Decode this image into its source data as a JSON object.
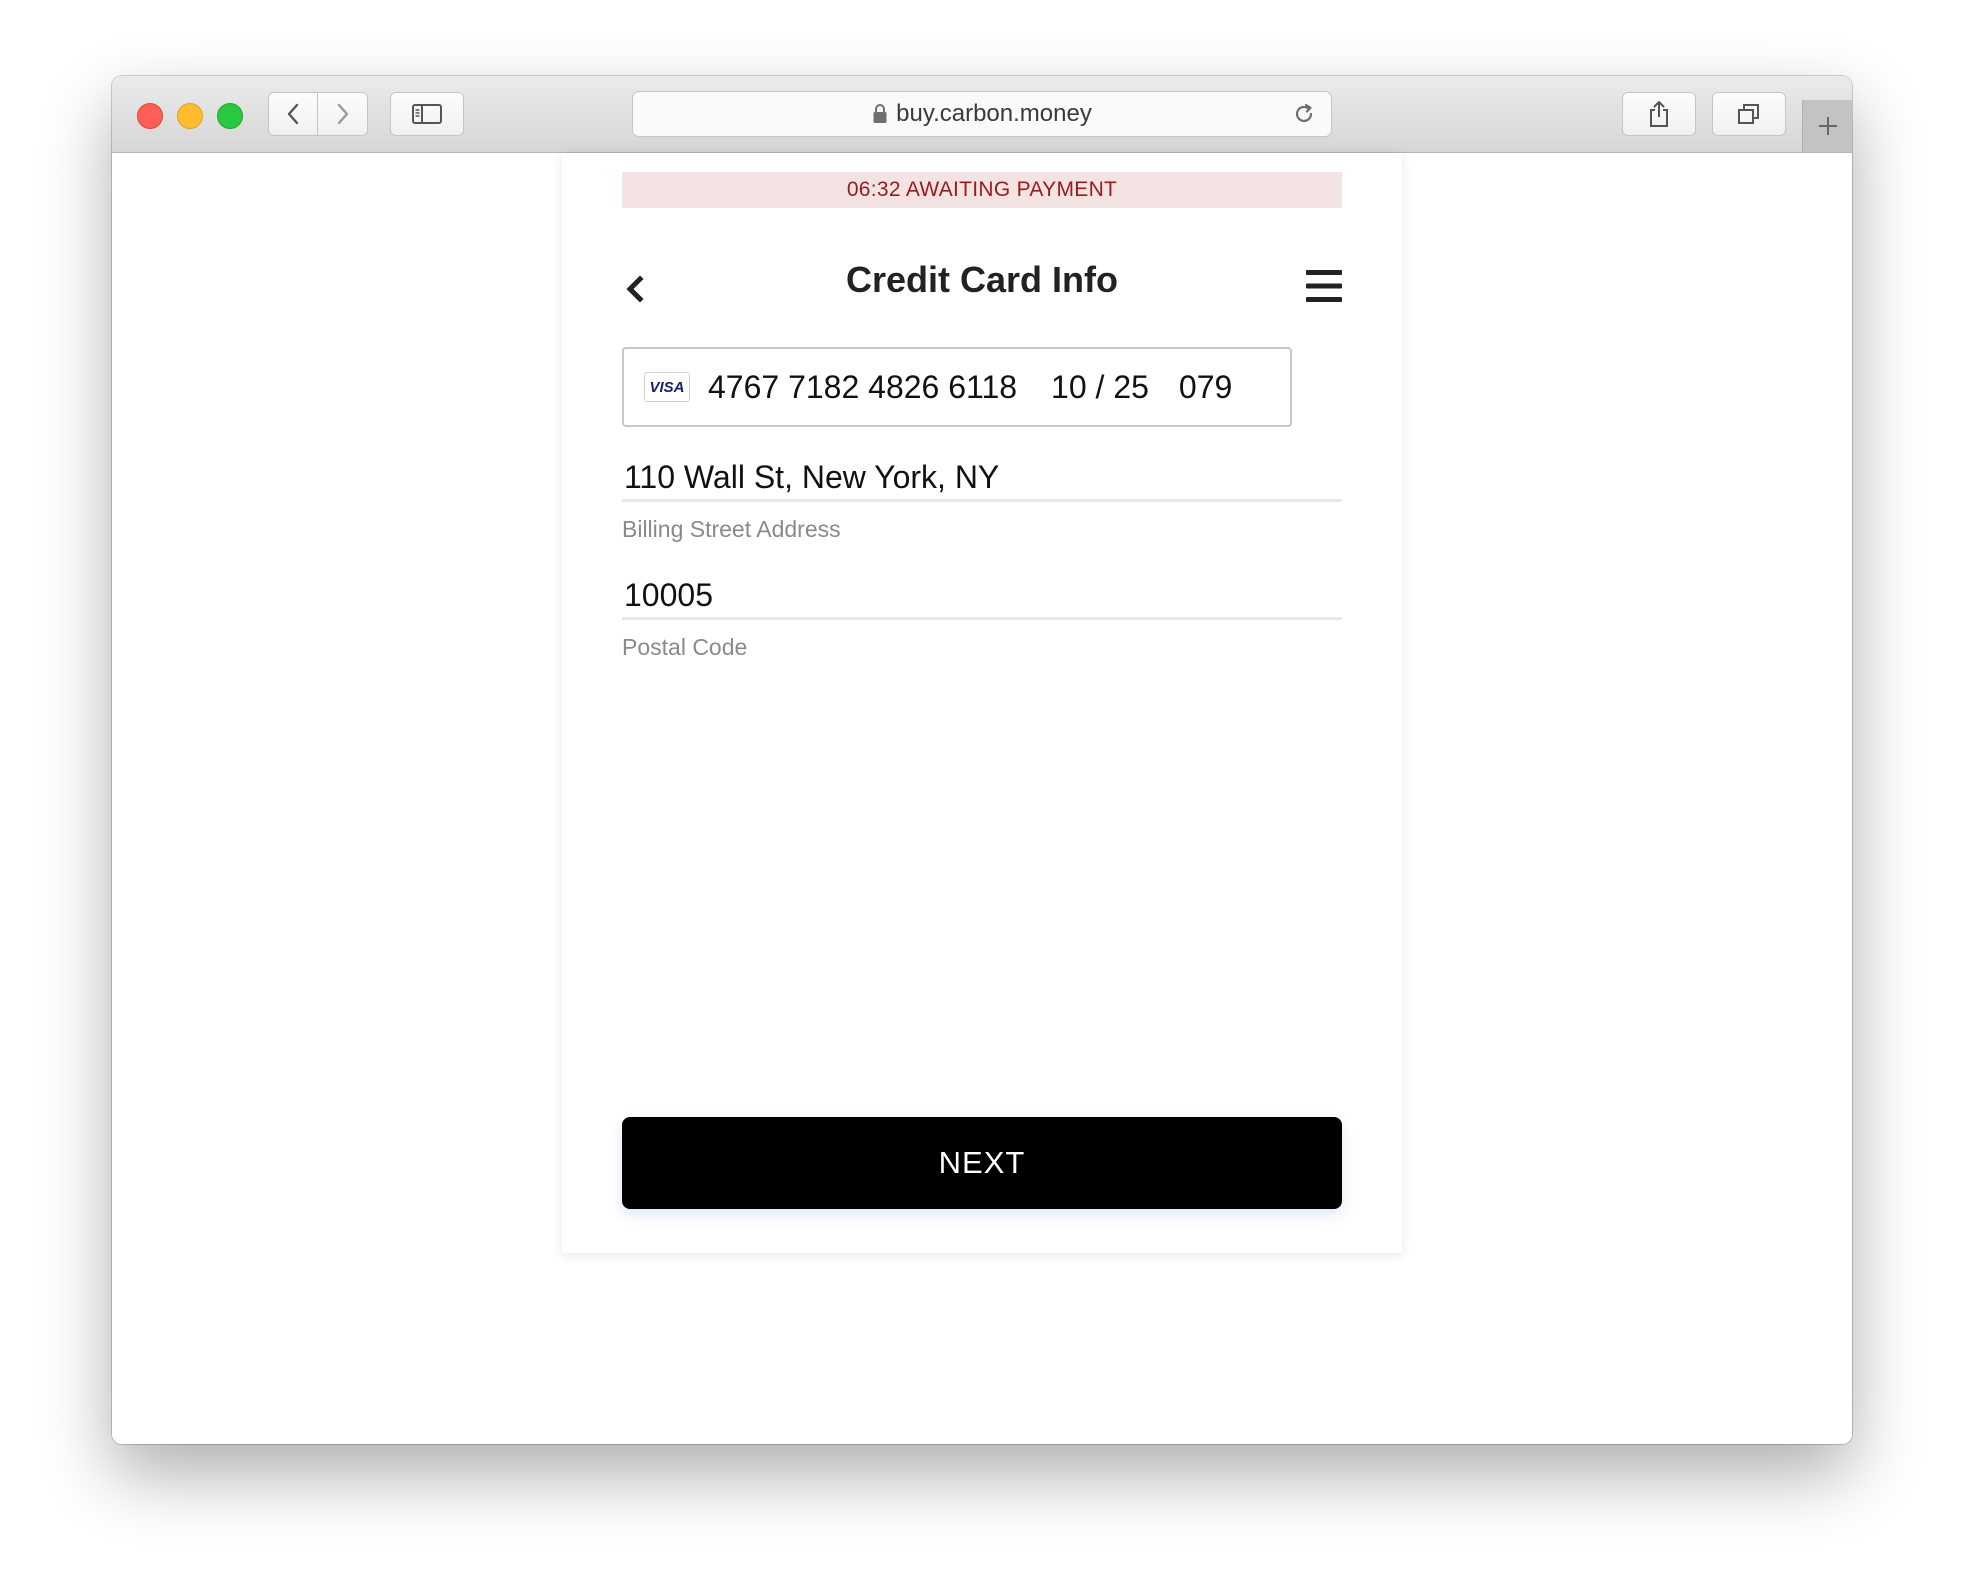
{
  "browser": {
    "url": "buy.carbon.money"
  },
  "page": {
    "status_banner": "06:32 AWAITING PAYMENT",
    "title": "Credit Card Info",
    "card": {
      "brand": "VISA",
      "number": "4767 7182 4826 6118",
      "expiry": "10 / 25",
      "cvc": "079"
    },
    "billing_address": {
      "value": "110 Wall St, New York, NY",
      "label": "Billing Street Address"
    },
    "postal_code": {
      "value": "10005",
      "label": "Postal Code"
    },
    "next_label": "NEXT"
  },
  "colors": {
    "banner_bg": "#f3e3e3",
    "banner_text": "#9b1b1b",
    "button_bg": "#000000",
    "visa_blue": "#1a1f71"
  },
  "icons": [
    "back-chevron-icon",
    "menu-icon",
    "lock-icon",
    "reload-icon",
    "share-icon",
    "tabs-icon",
    "sidebar-icon",
    "plus-icon"
  ]
}
